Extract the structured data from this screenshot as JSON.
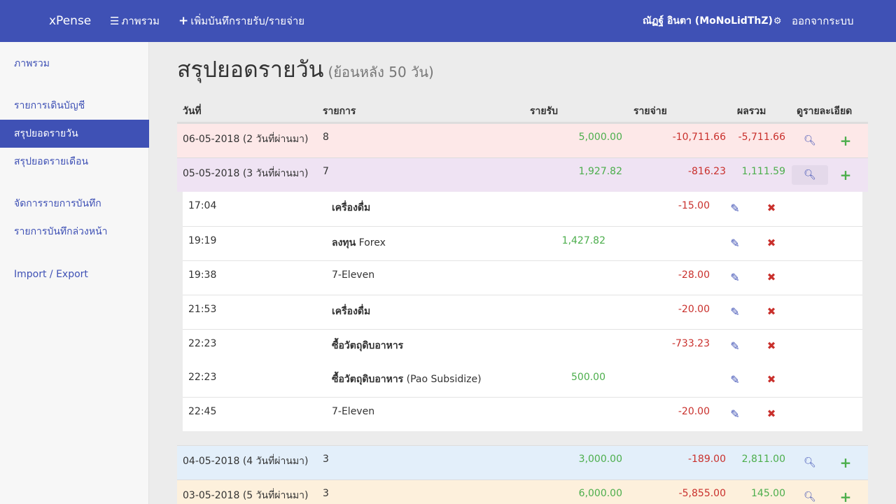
{
  "navbar": {
    "brand": "xPense",
    "overview_label": "ภาพรวม",
    "add_label": "เพิ่มบันทึกรายรับ/รายจ่าย",
    "user_label": "ณัฏฐ์ อินตา (MoNoLidThZ)",
    "logout_label": "ออกจากระบบ"
  },
  "sidebar": {
    "items": [
      {
        "label": "ภาพรวม"
      },
      {
        "label": "รายการเดินบัญชี"
      },
      {
        "label": "สรุปยอดรายวัน"
      },
      {
        "label": "สรุปยอดรายเดือน"
      },
      {
        "label": "จัดการรายการบันทึก"
      },
      {
        "label": "รายการบันทึกล่วงหน้า"
      },
      {
        "label": "Import / Export"
      }
    ],
    "active_index": 2
  },
  "page": {
    "title": "สรุปยอดรายวัน",
    "subtitle": "(ย้อนหลัง 50 วัน)"
  },
  "table": {
    "headers": {
      "date": "วันที่",
      "items": "รายการ",
      "income": "รายรับ",
      "expense": "รายจ่าย",
      "total": "ผลรวม",
      "detail": "ดูรายละเอียด"
    },
    "rows": [
      {
        "date": "06-05-2018",
        "ago": "(2 วันที่ผ่านมา)",
        "count": "8",
        "income": "5,000.00",
        "expense": "-10,711.66",
        "total": "-5,711.66"
      },
      {
        "date": "05-05-2018",
        "ago": "(3 วันที่ผ่านมา)",
        "count": "7",
        "income": "1,927.82",
        "expense": "-816.23",
        "total": "1,111.59"
      },
      {
        "date": "04-05-2018",
        "ago": "(4 วันที่ผ่านมา)",
        "count": "3",
        "income": "3,000.00",
        "expense": "-189.00",
        "total": "2,811.00"
      },
      {
        "date": "03-05-2018",
        "ago": "(5 วันที่ผ่านมา)",
        "count": "3",
        "income": "6,000.00",
        "expense": "-5,855.00",
        "total": "145.00"
      }
    ]
  },
  "detail": {
    "entries": [
      {
        "time": "17:04",
        "title": "เครื่องดื่ม",
        "extra": "",
        "income": "",
        "expense": "-15.00"
      },
      {
        "time": "19:19",
        "title": "ลงทุน",
        "extra": " Forex",
        "income": "1,427.82",
        "expense": ""
      },
      {
        "time": "19:38",
        "title": "",
        "extra": "7-Eleven",
        "income": "",
        "expense": "-28.00"
      },
      {
        "time": "21:53",
        "title": "เครื่องดื่ม",
        "extra": "",
        "income": "",
        "expense": "-20.00"
      },
      {
        "time": "22:23",
        "title": "ซื้อวัตถุดิบอาหาร",
        "extra": "",
        "income": "",
        "expense": "-733.23"
      },
      {
        "time": "22:23",
        "title": "ซื้อวัตถุดิบอาหาร",
        "extra": " (Pao Subsidize)",
        "income": "500.00",
        "expense": ""
      },
      {
        "time": "22:45",
        "title": "",
        "extra": "7-Eleven",
        "income": "",
        "expense": "-20.00"
      }
    ]
  },
  "colors": {
    "primary": "#3f51b5",
    "positive": "#4cae4c",
    "negative": "#c9302c",
    "row_danger": "#fde8e8",
    "row_purple": "#efe3f3",
    "row_info": "#e3effa",
    "row_warning": "#fdf0dc"
  }
}
